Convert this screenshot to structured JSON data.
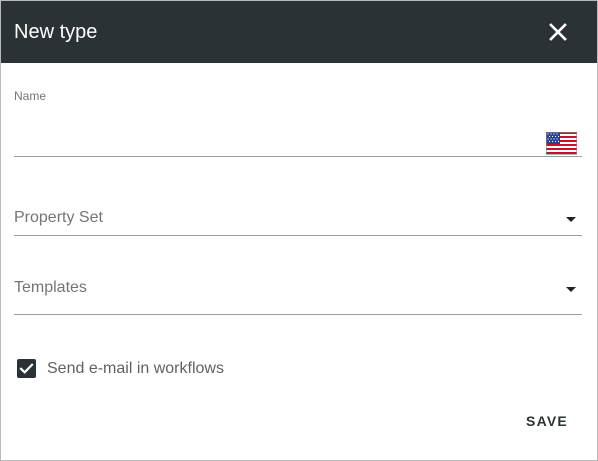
{
  "dialog": {
    "title": "New type",
    "close_icon": "close-icon",
    "header_color": "#2b3236"
  },
  "name_field": {
    "label": "Name",
    "value": "",
    "language_icon": "us-flag-icon"
  },
  "property_set": {
    "placeholder": "Property Set",
    "icon": "dropdown-arrow-icon"
  },
  "templates": {
    "placeholder": "Templates",
    "icon": "dropdown-arrow-icon"
  },
  "send_email": {
    "label": "Send e-mail in workflows",
    "checked": true,
    "icon": "checkmark-icon"
  },
  "actions": {
    "save_label": "SAVE"
  }
}
